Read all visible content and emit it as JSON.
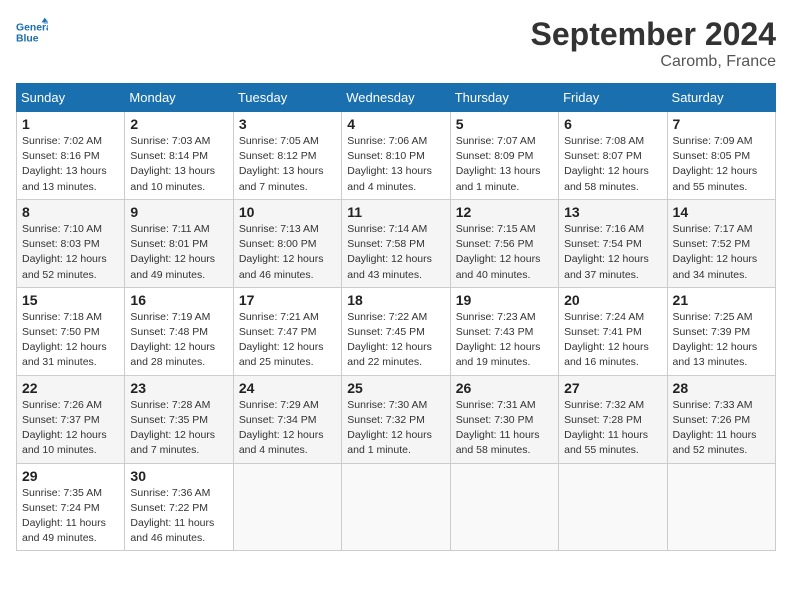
{
  "header": {
    "logo_line1": "General",
    "logo_line2": "Blue",
    "month_year": "September 2024",
    "location": "Caromb, France"
  },
  "columns": [
    "Sunday",
    "Monday",
    "Tuesday",
    "Wednesday",
    "Thursday",
    "Friday",
    "Saturday"
  ],
  "weeks": [
    [
      {
        "day": "1",
        "info": "Sunrise: 7:02 AM\nSunset: 8:16 PM\nDaylight: 13 hours\nand 13 minutes."
      },
      {
        "day": "2",
        "info": "Sunrise: 7:03 AM\nSunset: 8:14 PM\nDaylight: 13 hours\nand 10 minutes."
      },
      {
        "day": "3",
        "info": "Sunrise: 7:05 AM\nSunset: 8:12 PM\nDaylight: 13 hours\nand 7 minutes."
      },
      {
        "day": "4",
        "info": "Sunrise: 7:06 AM\nSunset: 8:10 PM\nDaylight: 13 hours\nand 4 minutes."
      },
      {
        "day": "5",
        "info": "Sunrise: 7:07 AM\nSunset: 8:09 PM\nDaylight: 13 hours\nand 1 minute."
      },
      {
        "day": "6",
        "info": "Sunrise: 7:08 AM\nSunset: 8:07 PM\nDaylight: 12 hours\nand 58 minutes."
      },
      {
        "day": "7",
        "info": "Sunrise: 7:09 AM\nSunset: 8:05 PM\nDaylight: 12 hours\nand 55 minutes."
      }
    ],
    [
      {
        "day": "8",
        "info": "Sunrise: 7:10 AM\nSunset: 8:03 PM\nDaylight: 12 hours\nand 52 minutes."
      },
      {
        "day": "9",
        "info": "Sunrise: 7:11 AM\nSunset: 8:01 PM\nDaylight: 12 hours\nand 49 minutes."
      },
      {
        "day": "10",
        "info": "Sunrise: 7:13 AM\nSunset: 8:00 PM\nDaylight: 12 hours\nand 46 minutes."
      },
      {
        "day": "11",
        "info": "Sunrise: 7:14 AM\nSunset: 7:58 PM\nDaylight: 12 hours\nand 43 minutes."
      },
      {
        "day": "12",
        "info": "Sunrise: 7:15 AM\nSunset: 7:56 PM\nDaylight: 12 hours\nand 40 minutes."
      },
      {
        "day": "13",
        "info": "Sunrise: 7:16 AM\nSunset: 7:54 PM\nDaylight: 12 hours\nand 37 minutes."
      },
      {
        "day": "14",
        "info": "Sunrise: 7:17 AM\nSunset: 7:52 PM\nDaylight: 12 hours\nand 34 minutes."
      }
    ],
    [
      {
        "day": "15",
        "info": "Sunrise: 7:18 AM\nSunset: 7:50 PM\nDaylight: 12 hours\nand 31 minutes."
      },
      {
        "day": "16",
        "info": "Sunrise: 7:19 AM\nSunset: 7:48 PM\nDaylight: 12 hours\nand 28 minutes."
      },
      {
        "day": "17",
        "info": "Sunrise: 7:21 AM\nSunset: 7:47 PM\nDaylight: 12 hours\nand 25 minutes."
      },
      {
        "day": "18",
        "info": "Sunrise: 7:22 AM\nSunset: 7:45 PM\nDaylight: 12 hours\nand 22 minutes."
      },
      {
        "day": "19",
        "info": "Sunrise: 7:23 AM\nSunset: 7:43 PM\nDaylight: 12 hours\nand 19 minutes."
      },
      {
        "day": "20",
        "info": "Sunrise: 7:24 AM\nSunset: 7:41 PM\nDaylight: 12 hours\nand 16 minutes."
      },
      {
        "day": "21",
        "info": "Sunrise: 7:25 AM\nSunset: 7:39 PM\nDaylight: 12 hours\nand 13 minutes."
      }
    ],
    [
      {
        "day": "22",
        "info": "Sunrise: 7:26 AM\nSunset: 7:37 PM\nDaylight: 12 hours\nand 10 minutes."
      },
      {
        "day": "23",
        "info": "Sunrise: 7:28 AM\nSunset: 7:35 PM\nDaylight: 12 hours\nand 7 minutes."
      },
      {
        "day": "24",
        "info": "Sunrise: 7:29 AM\nSunset: 7:34 PM\nDaylight: 12 hours\nand 4 minutes."
      },
      {
        "day": "25",
        "info": "Sunrise: 7:30 AM\nSunset: 7:32 PM\nDaylight: 12 hours\nand 1 minute."
      },
      {
        "day": "26",
        "info": "Sunrise: 7:31 AM\nSunset: 7:30 PM\nDaylight: 11 hours\nand 58 minutes."
      },
      {
        "day": "27",
        "info": "Sunrise: 7:32 AM\nSunset: 7:28 PM\nDaylight: 11 hours\nand 55 minutes."
      },
      {
        "day": "28",
        "info": "Sunrise: 7:33 AM\nSunset: 7:26 PM\nDaylight: 11 hours\nand 52 minutes."
      }
    ],
    [
      {
        "day": "29",
        "info": "Sunrise: 7:35 AM\nSunset: 7:24 PM\nDaylight: 11 hours\nand 49 minutes."
      },
      {
        "day": "30",
        "info": "Sunrise: 7:36 AM\nSunset: 7:22 PM\nDaylight: 11 hours\nand 46 minutes."
      },
      {
        "day": "",
        "info": ""
      },
      {
        "day": "",
        "info": ""
      },
      {
        "day": "",
        "info": ""
      },
      {
        "day": "",
        "info": ""
      },
      {
        "day": "",
        "info": ""
      }
    ]
  ]
}
